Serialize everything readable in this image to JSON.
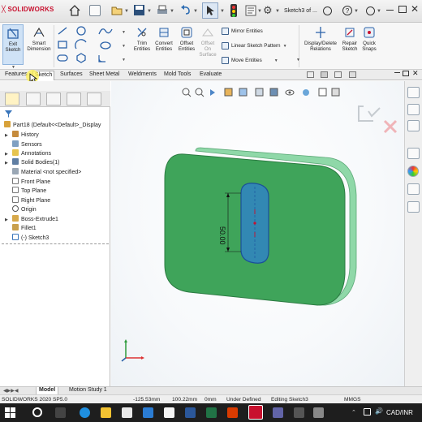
{
  "app": {
    "logo_text": "SOLIDWORKS",
    "window_title": "Sketch3 of ..."
  },
  "ribbon": {
    "exit_sketch": "Exit\nSketch",
    "smart_dimension": "Smart\nDimension",
    "trim_entities": "Trim\nEntities",
    "convert_entities": "Convert\nEntities",
    "offset_entities": "Offset\nEntities",
    "offset_on_surface": "Offset\nOn\nSurface",
    "mirror_entities": "Mirror Entities",
    "linear_sketch_pattern": "Linear Sketch Pattern",
    "move_entities": "Move Entities",
    "display_delete_relations": "Display/Delete\nRelations",
    "repair_sketch": "Repair\nSketch",
    "quick_snaps": "Quick\nSnaps"
  },
  "tabs": [
    "Features",
    "Sketch",
    "Surfaces",
    "Sheet Metal",
    "Weldments",
    "Mold Tools",
    "Evaluate"
  ],
  "active_tab": "Sketch",
  "tree": {
    "root": "Part18  (Default<<Default>_Display",
    "items": [
      {
        "label": "History",
        "icon": "history-icon"
      },
      {
        "label": "Sensors",
        "icon": "sensors-icon"
      },
      {
        "label": "Annotations",
        "icon": "annotations-icon"
      },
      {
        "label": "Solid Bodies(1)",
        "icon": "solid-bodies-icon"
      },
      {
        "label": "Material <not specified>",
        "icon": "material-icon"
      },
      {
        "label": "Front Plane",
        "icon": "plane-icon"
      },
      {
        "label": "Top Plane",
        "icon": "plane-icon"
      },
      {
        "label": "Right Plane",
        "icon": "plane-icon"
      },
      {
        "label": "Origin",
        "icon": "origin-icon"
      },
      {
        "label": "Boss-Extrude1",
        "icon": "extrude-icon"
      },
      {
        "label": "Fillet1",
        "icon": "fillet-icon"
      },
      {
        "label": "(-) Sketch3",
        "icon": "sketch-icon"
      }
    ]
  },
  "viewport": {
    "dimension_label": "50.00",
    "colors": {
      "part_face": "#3fa45a",
      "part_side": "#8fd8a8",
      "slot_fill": "#2f7fd1",
      "accent": "#c8102e"
    }
  },
  "bottom_tabs": [
    "Model",
    "Motion Study 1"
  ],
  "status": {
    "version": "SOLIDWORKS 2020 SP5.0",
    "x": "-125.53mm",
    "y": "100.22mm",
    "z": "0mm",
    "state": "Under Defined",
    "editing": "Editing Sketch3",
    "units": "MMGS"
  },
  "taskbar": {
    "tray_text": "CAD/INR"
  }
}
